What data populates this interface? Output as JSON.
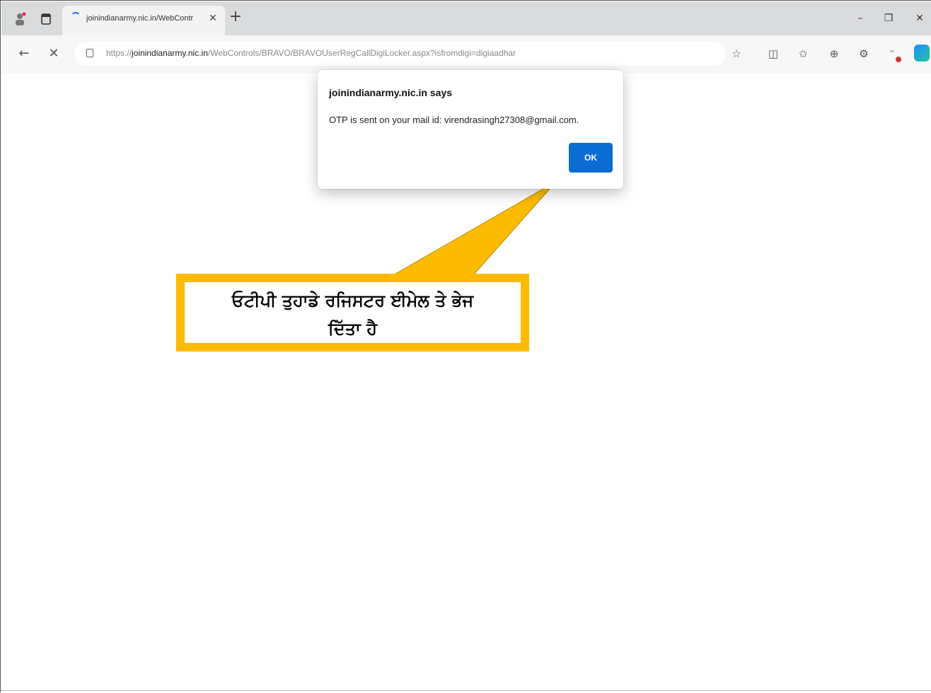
{
  "browser": {
    "tab": {
      "title": "joinindianarmy.nic.in/WebContr",
      "close": "✕"
    },
    "new_tab": "+",
    "window_controls": {
      "minimize": "–",
      "restore": "❐",
      "close": "✕"
    },
    "nav": {
      "back": "←",
      "stop": "✕"
    },
    "address": {
      "prefix": "https://",
      "host": "joinindianarmy.nic.in",
      "path": "/WebControls/BRAVO/BRAVOUserRegCallDigiLocker.aspx?isfromdigi=digiaadhar"
    },
    "toolbar_icons": [
      "star-icon",
      "split-screen-icon",
      "favorites-icon",
      "collections-icon",
      "extensions-icon",
      "profile-icon",
      "copilot-icon"
    ]
  },
  "dialog": {
    "title": "joinindianarmy.nic.in says",
    "message": "OTP is sent on your mail id: virendrasingh27308@gmail.com.",
    "ok_label": "OK"
  },
  "callout": {
    "line1": "ਓਟੀਪੀ ਤੁਹਾਡੇ ਰਜਿਸਟਰ ਈਮੇਲ ਤੇ ਭੇਜ",
    "line2": "ਦਿੱਤਾ ਹੈ",
    "color": "#fdbb00"
  }
}
